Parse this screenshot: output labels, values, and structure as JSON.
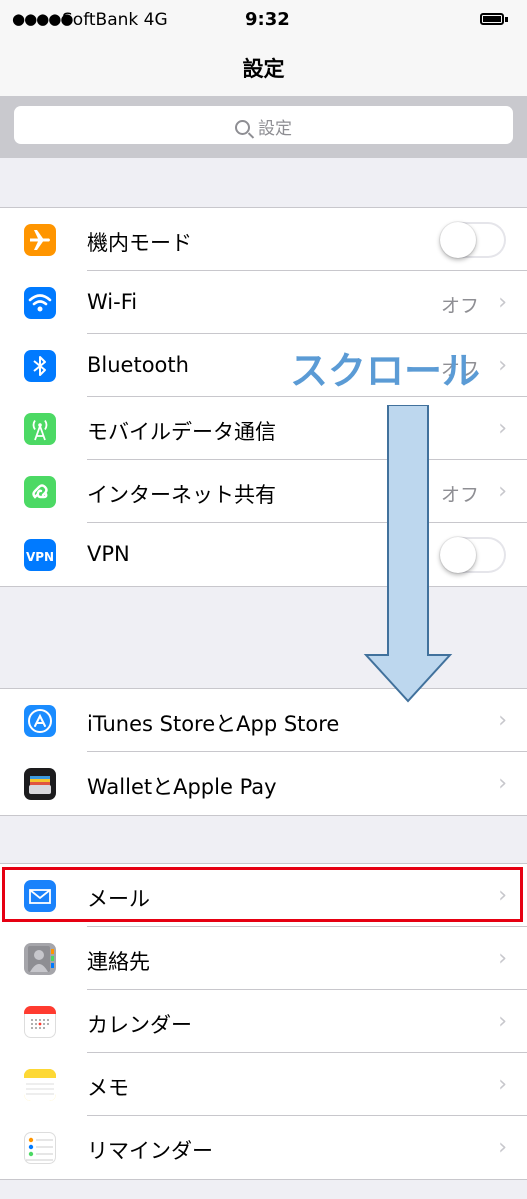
{
  "status_bar": {
    "signal": "●●●●●",
    "carrier": "SoftBank 4G",
    "time": "9:32",
    "battery_icon": "battery-full-icon"
  },
  "nav": {
    "title": "設定"
  },
  "search": {
    "placeholder": "設定",
    "icon": "search-icon"
  },
  "groups": [
    {
      "rows": [
        {
          "label": "機内モード",
          "icon": "airplane-icon",
          "icon_color": "#ff9500",
          "accessory": "toggle",
          "toggle_on": false
        },
        {
          "label": "Wi-Fi",
          "icon": "wifi-icon",
          "icon_color": "#007aff",
          "accessory": "chevron",
          "value": "オフ"
        },
        {
          "label": "Bluetooth",
          "icon": "bluetooth-icon",
          "icon_color": "#007aff",
          "accessory": "chevron",
          "value": "オフ"
        },
        {
          "label": "モバイルデータ通信",
          "icon": "cellular-icon",
          "icon_color": "#4cd964",
          "accessory": "chevron"
        },
        {
          "label": "インターネット共有",
          "icon": "hotspot-icon",
          "icon_color": "#4cd964",
          "accessory": "chevron",
          "value": "オフ"
        },
        {
          "label": "VPN",
          "icon": "vpn-icon",
          "icon_color": "#007aff",
          "icon_text": "VPN",
          "accessory": "toggle",
          "toggle_on": false
        }
      ]
    },
    {
      "rows": [
        {
          "label": "iTunes StoreとApp Store",
          "icon": "app-store-icon",
          "icon_color": "#1a8cff",
          "accessory": "chevron"
        },
        {
          "label": "WalletとApple Pay",
          "icon": "wallet-icon",
          "icon_color": "#1c1c1e",
          "accessory": "chevron"
        }
      ]
    },
    {
      "rows": [
        {
          "label": "メール",
          "icon": "mail-icon",
          "icon_color": "#1a82fb",
          "accessory": "chevron"
        },
        {
          "label": "連絡先",
          "icon": "contacts-icon",
          "icon_color": "#a5a5aa",
          "accessory": "chevron"
        },
        {
          "label": "カレンダー",
          "icon": "calendar-icon",
          "icon_color": "#ffffff",
          "accessory": "chevron"
        },
        {
          "label": "メモ",
          "icon": "notes-icon",
          "icon_color": "#fdd835",
          "accessory": "chevron"
        },
        {
          "label": "リマインダー",
          "icon": "reminders-icon",
          "icon_color": "#ffffff",
          "accessory": "chevron"
        }
      ]
    }
  ],
  "annotation": {
    "text": "スクロール",
    "text_color": "#5b9bd5",
    "arrow_icon": "down-arrow-icon",
    "arrow_fill": "#bdd7ee",
    "arrow_stroke": "#41719c",
    "highlight_color": "#e60012",
    "highlighted_row": "メール"
  }
}
